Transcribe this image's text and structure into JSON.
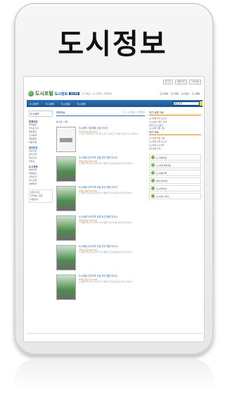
{
  "page_title": "도시정보",
  "site": {
    "logo_text": "도시포털",
    "logo_sub": "도시정보",
    "logo_badge": "정보마당",
    "breadcrumb": "도시정보 > 도시정책 > 정책자료",
    "util_buttons": [
      "로그인",
      "회원가입",
      "사이트맵"
    ],
    "top_links": [
      "도시계획",
      "도시재생",
      "도시정보",
      "도시개발"
    ],
    "nav": [
      "도시정책",
      "도시계획",
      "도시재생",
      "도시정보"
    ],
    "search_placeholder": "통합검색"
  },
  "sidebar": {
    "title": "도시정보",
    "sections": [
      {
        "head": "정책자료",
        "items": [
          "정책동향",
          "연구보고서",
          "법령정보",
          "도시통계",
          "해외동향",
          "지원사업"
        ]
      },
      {
        "head": "정보마당",
        "items": [
          "보도자료",
          "공지사항",
          "행사안내",
          "자료실"
        ]
      },
      {
        "head": "도시재생",
        "items": [
          "재생사업",
          "재생정보",
          "사례소개",
          "우수사례",
          "참여마당"
        ]
      }
    ],
    "box_items": [
      "관련사이트",
      "자주하는 질문",
      "이용안내"
    ]
  },
  "main": {
    "header": "정책자료",
    "path": "홈 > 도시정보 > 정책자료",
    "count": "총 9건 / 1쪽",
    "items": [
      {
        "title": "도시정보 기본계획 수립 보고서",
        "meta": "작성자 정보 2012.03",
        "body": "도시정보 기본계획 수립을 위한 기초 조사와 연구 내용을 정리한 보고서입니다."
      },
      {
        "title": "도시재생 선도지역 사업 추진 현황 보고서",
        "meta": "작성자 정보 2012.03",
        "body": "도시재생 선도지역 사업의 추진 현황과 주요 성과를 정리한 자료입니다."
      },
      {
        "title": "도시재생 선도지역 사업 추진 현황 보고서",
        "meta": "작성자 정보 2012.03",
        "body": "도시재생 선도지역 사업의 추진 현황과 주요 성과를 정리한 자료입니다."
      },
      {
        "title": "도시재생 선도지역 사업 추진 현황 보고서",
        "meta": "작성자 정보 2012.03",
        "body": "도시재생 선도지역 사업의 추진 현황과 주요 성과를 정리한 자료입니다."
      },
      {
        "title": "도시재생 선도지역 사업 추진 현황 보고서",
        "meta": "작성자 정보 2012.03",
        "body": "도시재생 선도지역 사업의 추진 현황과 주요 성과를 정리한 자료입니다."
      },
      {
        "title": "도시재생 선도지역 사업 추진 현황 보고서",
        "meta": "작성자 정보 2012.03",
        "body": "도시재생 선도지역 사업의 추진 현황과 주요 성과를 정리한 자료입니다."
      }
    ]
  },
  "right": {
    "head1": "최근 등록 자료",
    "list1": [
      "도시재생 연구 보고서",
      "도시정보 서비스 안내",
      "정책 자료 모음집",
      "도시계획 현황 자료"
    ],
    "head2": "최근 자료",
    "list2": [
      "도시정책 발표 자료",
      "도시재생 사업 보고서",
      "도시정보 뉴스레터",
      "공지사항 안내"
    ],
    "services": [
      "도시재생정보",
      "도시재생 종합정보",
      "도시재생사업",
      "재생 참여마당",
      "도시계획정보",
      "도시정보 서비스"
    ]
  }
}
